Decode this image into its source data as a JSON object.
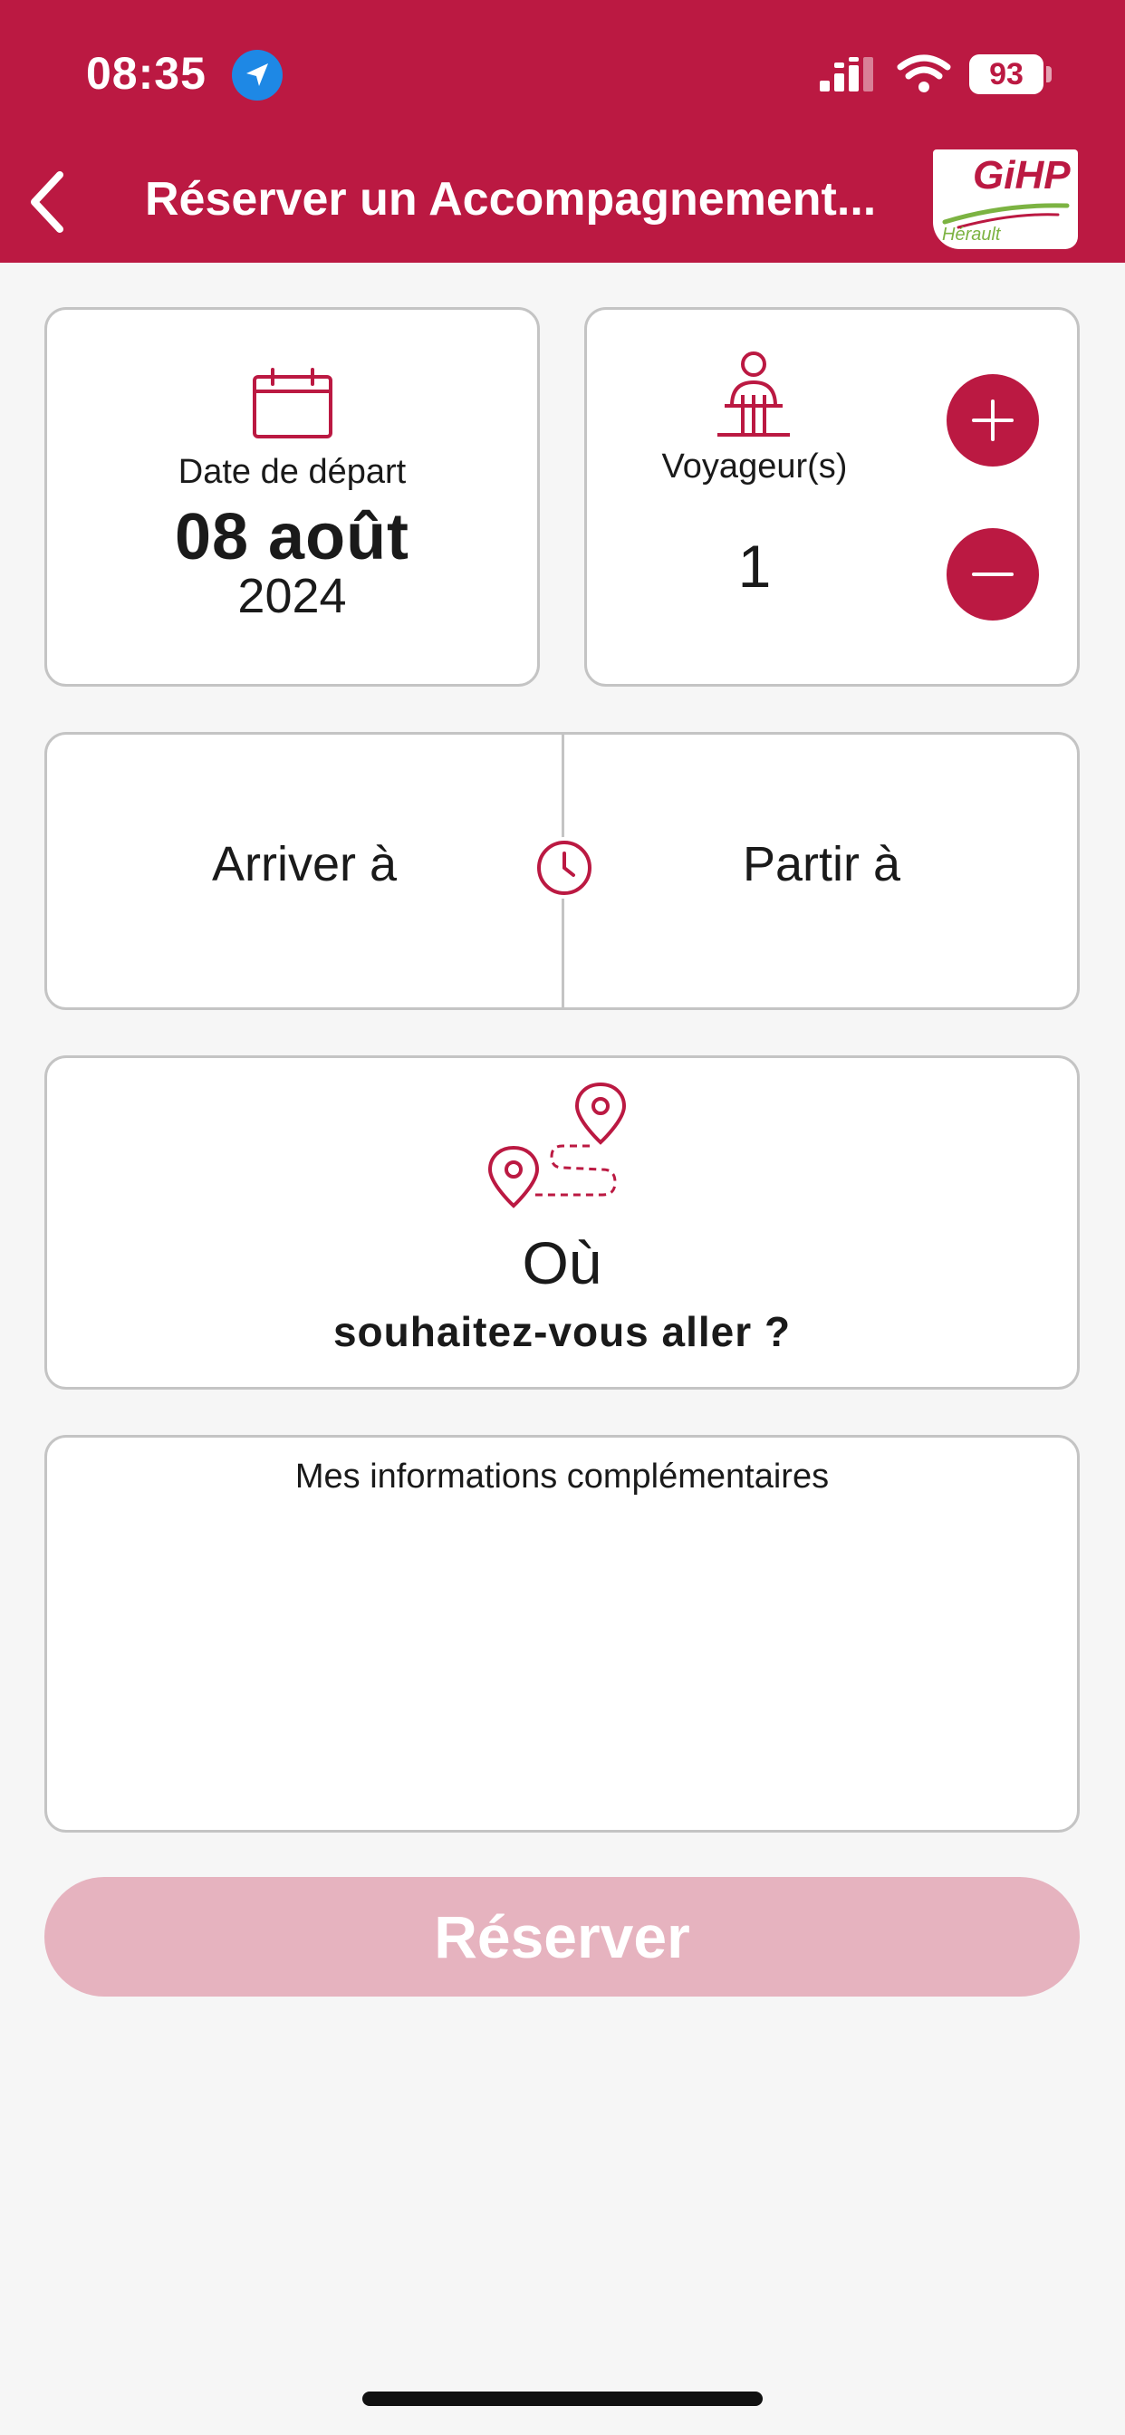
{
  "status": {
    "time": "08:35",
    "battery": "93"
  },
  "header": {
    "title": "Réserver un Accompagnement...",
    "logo": "GiHP",
    "logo_sub": "Hérault"
  },
  "date_card": {
    "label": "Date de départ",
    "day": "08 août",
    "year": "2024"
  },
  "travelers_card": {
    "label": "Voyageur(s)",
    "count": "1"
  },
  "time_card": {
    "arrive_label": "Arriver à",
    "depart_label": "Partir à"
  },
  "destination_card": {
    "title": "Où",
    "subtitle": "souhaitez-vous aller ?"
  },
  "info_card": {
    "label": "Mes informations complémentaires"
  },
  "reserve_button": {
    "label": "Réserver"
  },
  "colors": {
    "brand": "#bb1942",
    "disabled_button": "#e6b3bf",
    "background": "#f6f6f6"
  },
  "icons": [
    "location-arrow-icon",
    "signal-icon",
    "wifi-icon",
    "battery-icon",
    "back-chevron-icon",
    "calendar-icon",
    "traveler-icon",
    "plus-icon",
    "minus-icon",
    "clock-icon",
    "route-pins-icon"
  ]
}
